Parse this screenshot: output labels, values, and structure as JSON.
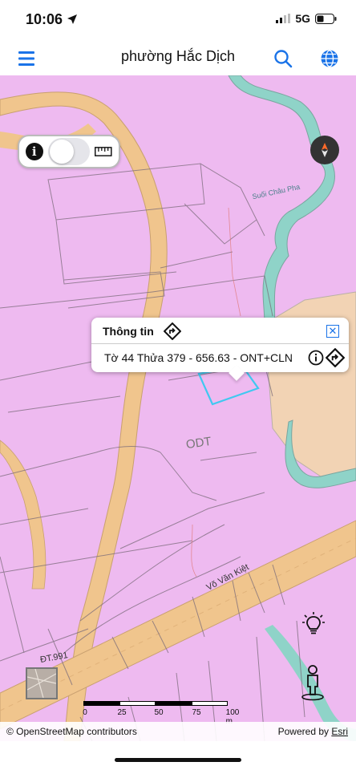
{
  "status": {
    "time": "10:06",
    "network": "5G"
  },
  "header": {
    "title": "phường Hắc Dịch"
  },
  "map": {
    "labels": {
      "stream": "Suối Châu Pha",
      "zone": "ODT",
      "road_main": "Võ Văn Kiệt",
      "road_secondary": "ĐT.991"
    },
    "colors": {
      "land_residential": "#eebaf0",
      "road": "#f0c58d",
      "water": "#8fd3c8",
      "farmland": "#f2d3b4",
      "parcel_outline": "#40c8f0"
    }
  },
  "popup": {
    "title": "Thông tin",
    "text": "Tờ 44 Thửa 379 - 656.63 - ONT+CLN"
  },
  "scalebar": {
    "labels": [
      "0",
      "25",
      "50",
      "75",
      "100 m"
    ]
  },
  "attribution": {
    "left": "© OpenStreetMap contributors",
    "right_prefix": "Powered by ",
    "right_link": "Esri"
  }
}
